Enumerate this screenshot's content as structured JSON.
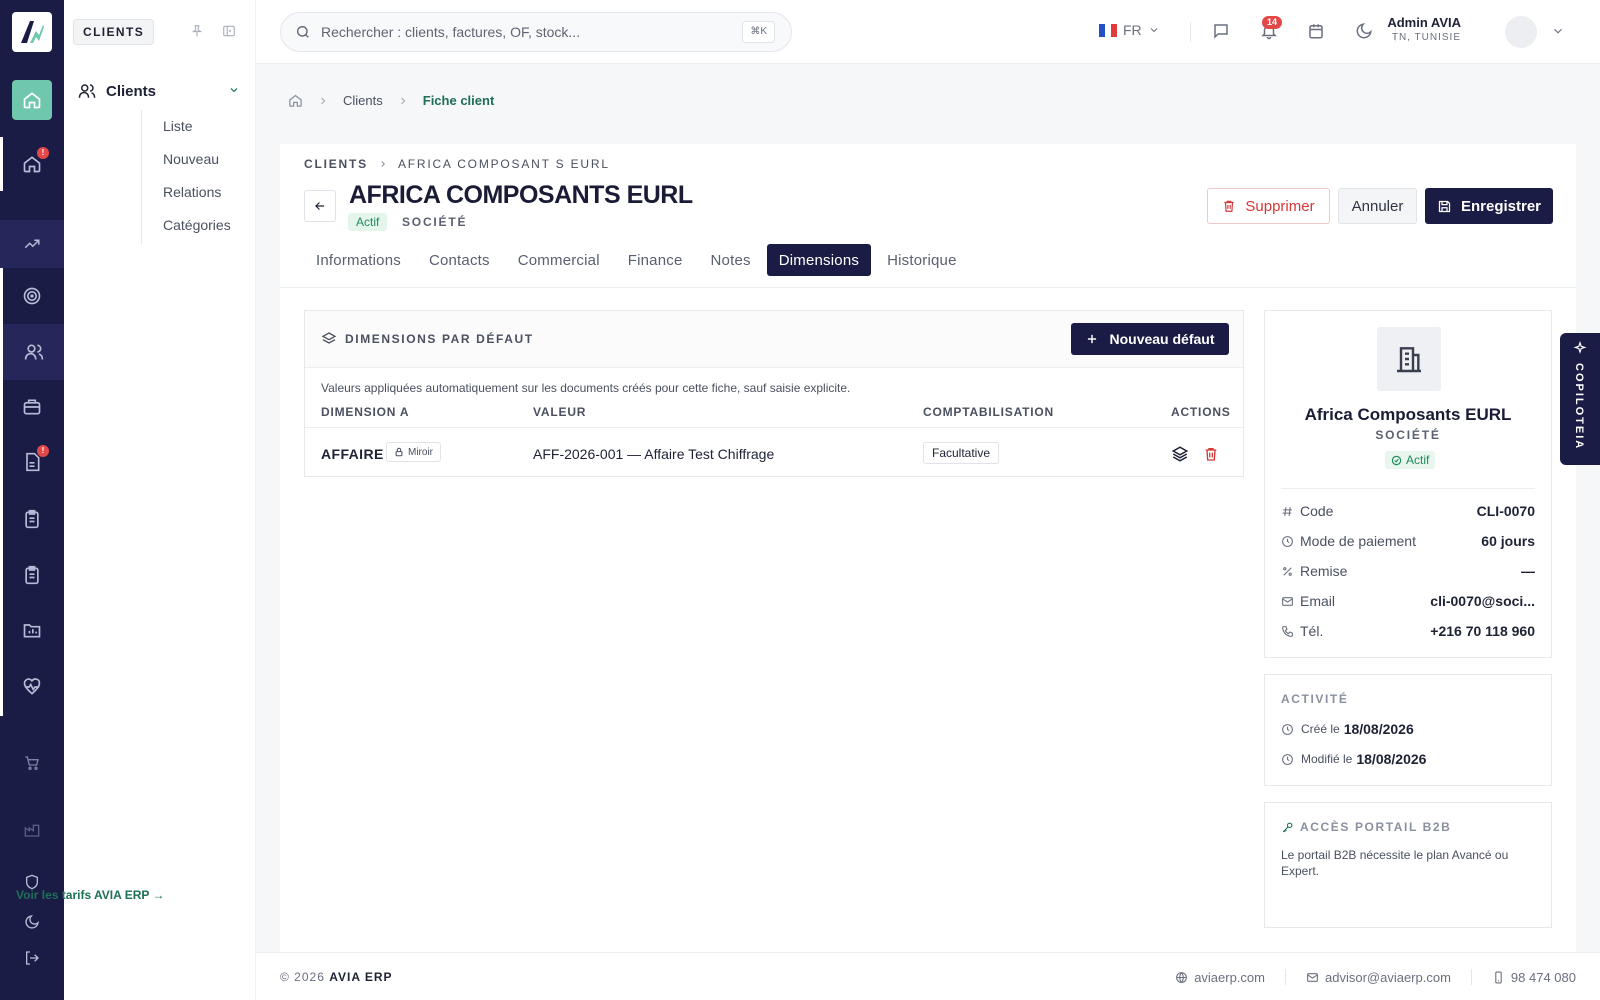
{
  "app": {
    "name": "AVIA ERP"
  },
  "rail": {
    "badge1": "!",
    "badge2": "!"
  },
  "subnav": {
    "tag": "CLIENTS",
    "group_label": "Clients",
    "items": [
      "Liste",
      "Nouveau",
      "Relations",
      "Catégories"
    ]
  },
  "topbar": {
    "search_placeholder": "Rechercher : clients, factures, OF, stock...",
    "search_shortcut": "⌘K",
    "lang": "FR",
    "notif_count": "14",
    "user_name": "Admin AVIA",
    "user_location": "TN, TUNISIE"
  },
  "breadcrumb": {
    "clients": "Clients",
    "current": "Fiche client"
  },
  "header": {
    "section": "CLIENTS",
    "entity": "AFRICA COMPOSANT S EURL",
    "title": "AFRICA COMPOSANTS EURL",
    "status": "Actif",
    "type": "SOCIÉTÉ",
    "delete_label": "Supprimer",
    "cancel_label": "Annuler",
    "save_label": "Enregistrer"
  },
  "tabs": [
    "Informations",
    "Contacts",
    "Commercial",
    "Finance",
    "Notes",
    "Dimensions",
    "Historique"
  ],
  "active_tab": "Dimensions",
  "dimensions": {
    "title": "DIMENSIONS PAR DÉFAUT",
    "new_label": "Nouveau défaut",
    "description": "Valeurs appliquées automatiquement sur les documents créés pour cette fiche, sauf saisie explicite.",
    "columns": [
      "DIMENSION A",
      "VALEUR",
      "COMPTABILISATION",
      "ACTIONS"
    ],
    "rows": [
      {
        "dimension": "AFFAIRE",
        "badge": "Miroir",
        "value": "AFF-2026-001 — Affaire Test Chiffrage",
        "accounting": "Facultative"
      }
    ]
  },
  "profile": {
    "name": "Africa Composants EURL",
    "type": "SOCIÉTÉ",
    "status": "Actif",
    "fields": [
      {
        "icon": "hash-icon",
        "label": "Code",
        "value": "CLI-0070"
      },
      {
        "icon": "clock-icon",
        "label": "Mode de paiement",
        "value": "60 jours"
      },
      {
        "icon": "percent-icon",
        "label": "Remise",
        "value": "—"
      },
      {
        "icon": "mail-icon",
        "label": "Email",
        "value": "cli-0070@soci..."
      },
      {
        "icon": "phone-icon",
        "label": "Tél.",
        "value": "+216 70 118 960"
      }
    ]
  },
  "activity": {
    "title": "ACTIVITÉ",
    "created_label": "Créé le",
    "created_value": "18/08/2026",
    "modified_label": "Modifié le",
    "modified_value": "18/08/2026"
  },
  "b2b": {
    "title": "ACCÈS PORTAIL B2B",
    "text": "Le portail B2B nécessite le plan Avancé ou Expert.",
    "link": "Voir les tarifs AVIA ERP →"
  },
  "copilot": {
    "label": "COPILOTEIA"
  },
  "footer": {
    "year": "© 2026",
    "brand": "AVIA ERP",
    "site": "aviaerp.com",
    "email": "advisor@aviaerp.com",
    "phone": "98 474 080"
  },
  "colors": {
    "navy": "#1b1c45",
    "accent": "#6fc7ae",
    "danger": "#d43838",
    "success": "#1f8a5f"
  }
}
